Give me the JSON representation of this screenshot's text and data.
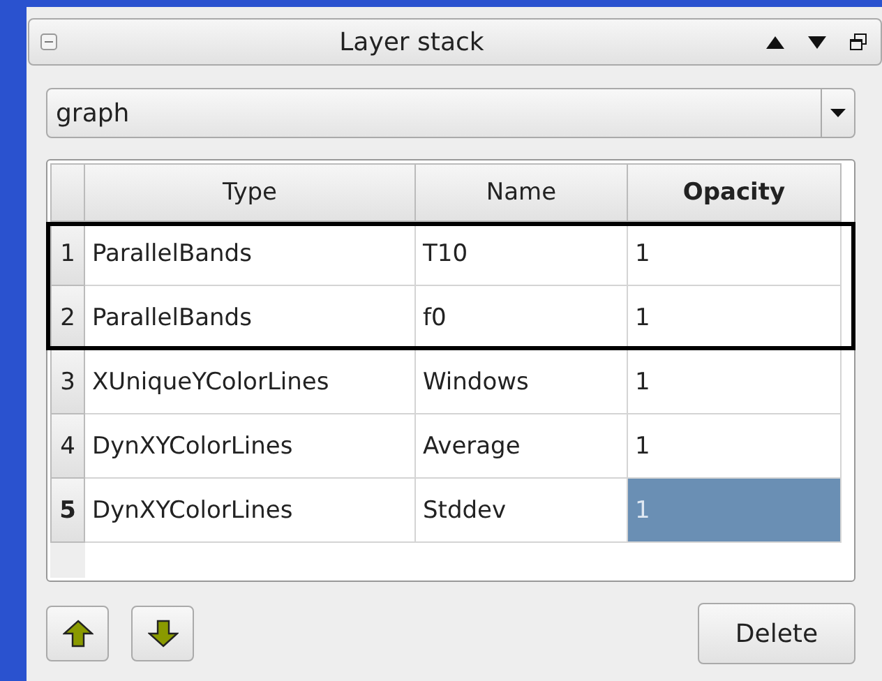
{
  "panel": {
    "title": "Layer stack"
  },
  "selector": {
    "value": "graph"
  },
  "table": {
    "columns": [
      {
        "label": "Type",
        "selected": false
      },
      {
        "label": "Name",
        "selected": false
      },
      {
        "label": "Opacity",
        "selected": true
      }
    ],
    "rows": [
      {
        "index": "1",
        "type": "ParallelBands",
        "name": "T10",
        "opacity": "1",
        "selected": true,
        "current": false
      },
      {
        "index": "2",
        "type": "ParallelBands",
        "name": "f0",
        "opacity": "1",
        "selected": true,
        "current": false
      },
      {
        "index": "3",
        "type": "XUniqueYColorLines",
        "name": "Windows",
        "opacity": "1",
        "selected": false,
        "current": false
      },
      {
        "index": "4",
        "type": "DynXYColorLines",
        "name": "Average",
        "opacity": "1",
        "selected": false,
        "current": false
      },
      {
        "index": "5",
        "type": "DynXYColorLines",
        "name": "Stddev",
        "opacity": "1",
        "selected": false,
        "current": true
      }
    ]
  },
  "buttons": {
    "delete": "Delete"
  }
}
